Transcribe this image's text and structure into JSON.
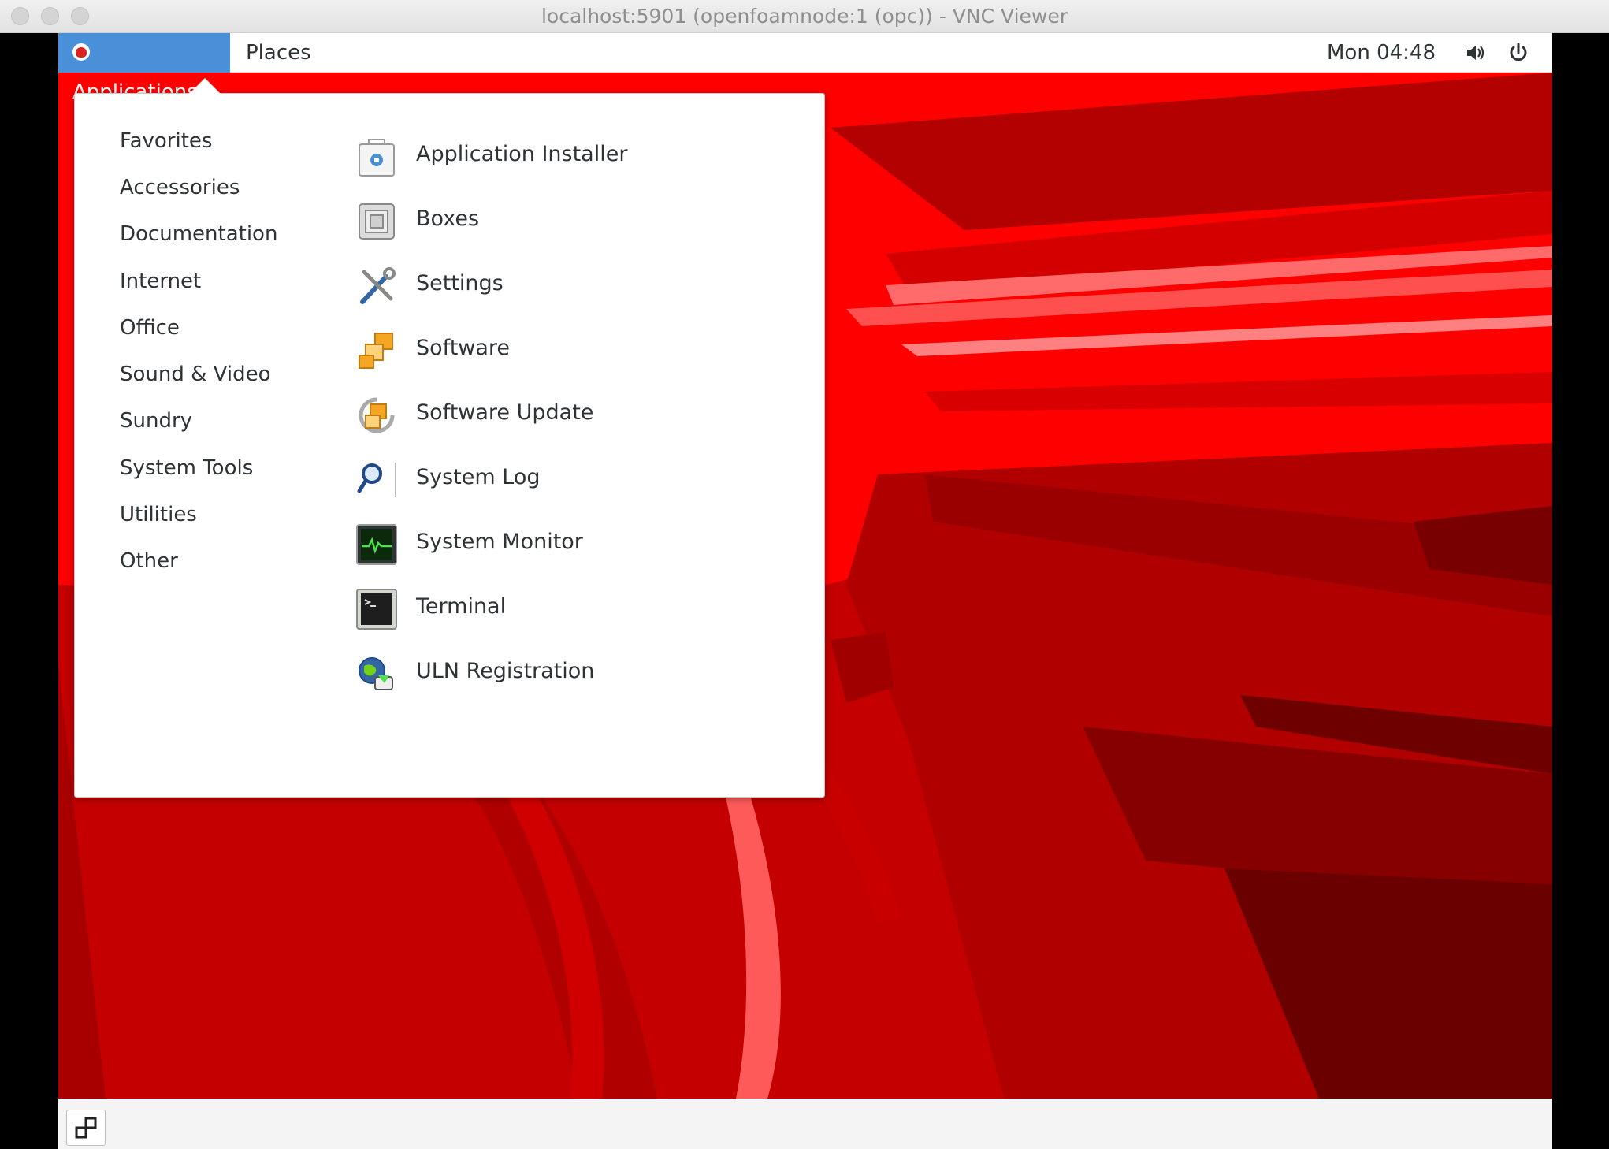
{
  "window": {
    "title": "localhost:5901 (openfoamnode:1 (opc)) - VNC Viewer"
  },
  "topbar": {
    "applications_label": "Applications",
    "places_label": "Places",
    "clock": "Mon 04:48"
  },
  "menu": {
    "categories": [
      {
        "label": "Favorites"
      },
      {
        "label": "Accessories"
      },
      {
        "label": "Documentation"
      },
      {
        "label": "Internet"
      },
      {
        "label": "Office"
      },
      {
        "label": "Sound & Video"
      },
      {
        "label": "Sundry"
      },
      {
        "label": "System Tools"
      },
      {
        "label": "Utilities"
      },
      {
        "label": "Other"
      }
    ],
    "apps": [
      {
        "label": "Application Installer",
        "icon": "application-installer-icon"
      },
      {
        "label": "Boxes",
        "icon": "boxes-icon"
      },
      {
        "label": "Settings",
        "icon": "settings-icon"
      },
      {
        "label": "Software",
        "icon": "software-icon"
      },
      {
        "label": "Software Update",
        "icon": "software-update-icon"
      },
      {
        "label": "System Log",
        "icon": "system-log-icon"
      },
      {
        "label": "System Monitor",
        "icon": "system-monitor-icon"
      },
      {
        "label": "Terminal",
        "icon": "terminal-icon"
      },
      {
        "label": "ULN Registration",
        "icon": "uln-registration-icon"
      }
    ]
  },
  "colors": {
    "accent": "#4a90d9",
    "wallpaper_red": "#ff0000",
    "wallpaper_dark": "#b10000"
  }
}
